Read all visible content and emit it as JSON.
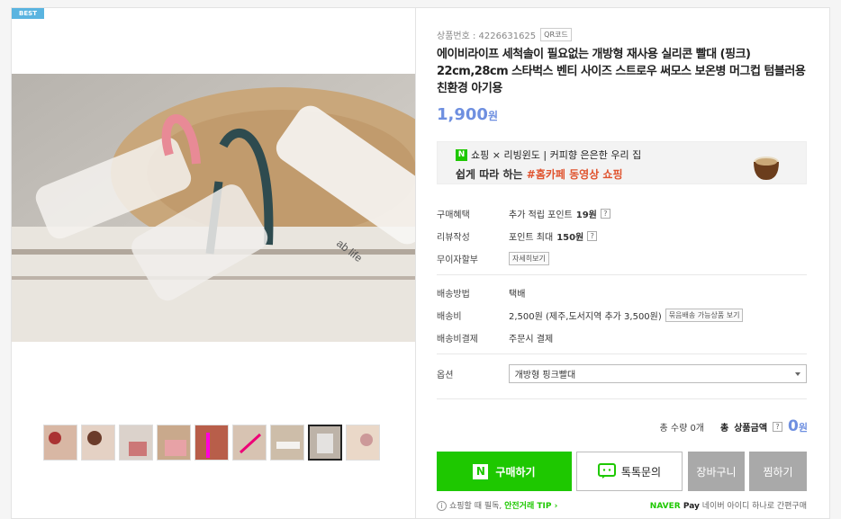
{
  "badge": "BEST",
  "product": {
    "code_label": "상품번호 : 4226631625",
    "qr_label": "QR코드",
    "title": "에이비라이프 세척솔이 필요없는 개방형 재사용 실리콘 빨대 (핑크) 22cm,28cm 스타벅스 벤티 사이즈 스트로우 써모스 보온병 머그컵 텀블러용 친환경 아기용",
    "price": "1,900",
    "currency": "원"
  },
  "banner": {
    "n_badge": "N",
    "line1": "쇼핑 × 리빙윈도 | 커피향 은은한 우리 집",
    "line2_prefix": "쉽게 따라 하는 ",
    "line2_highlight": "#홈카페 동영상 쇼핑"
  },
  "benefits": {
    "purchase_label": "구매혜택",
    "purchase_text": "추가 적립 포인트 ",
    "purchase_value": "19원",
    "review_label": "리뷰작성",
    "review_text": "포인트 최대 ",
    "review_value": "150원",
    "installment_label": "무이자할부",
    "installment_btn": "자세히보기",
    "help": "?"
  },
  "shipping": {
    "method_label": "배송방법",
    "method_value": "택배",
    "fee_label": "배송비",
    "fee_value": "2,500원 (제주,도서지역 추가 3,500원)",
    "bundle_btn": "묶음배송 가능상품 보기",
    "pay_label": "배송비결제",
    "pay_value": "주문시 결제"
  },
  "option": {
    "label": "옵션",
    "selected": "개방형 핑크빨대"
  },
  "total": {
    "qty_label": "총 수량 0개",
    "amount_label_prefix": "총",
    "amount_label": "상품금액",
    "help": "?",
    "amount": "0",
    "currency": "원"
  },
  "buttons": {
    "buy_icon": "N",
    "buy": "구매하기",
    "talk": "톡톡문의",
    "cart": "장바구니",
    "wish": "찜하기"
  },
  "footer": {
    "notice": "쇼핑할 때 필독, ",
    "safe": "안전거래 TIP ›",
    "naver": "NAVER",
    "pay": "Pay",
    "pay_desc": "네이버 아이디 하나로 간편구매"
  },
  "thumbnails": [
    "thumb-1",
    "thumb-2",
    "thumb-3",
    "thumb-4",
    "thumb-5",
    "thumb-6",
    "thumb-7",
    "thumb-8",
    "thumb-9"
  ],
  "colors": {
    "accent": "#1ec800",
    "price": "#6e8fe0",
    "highlight": "#e0532e",
    "gray_button": "#a9a9a9"
  }
}
